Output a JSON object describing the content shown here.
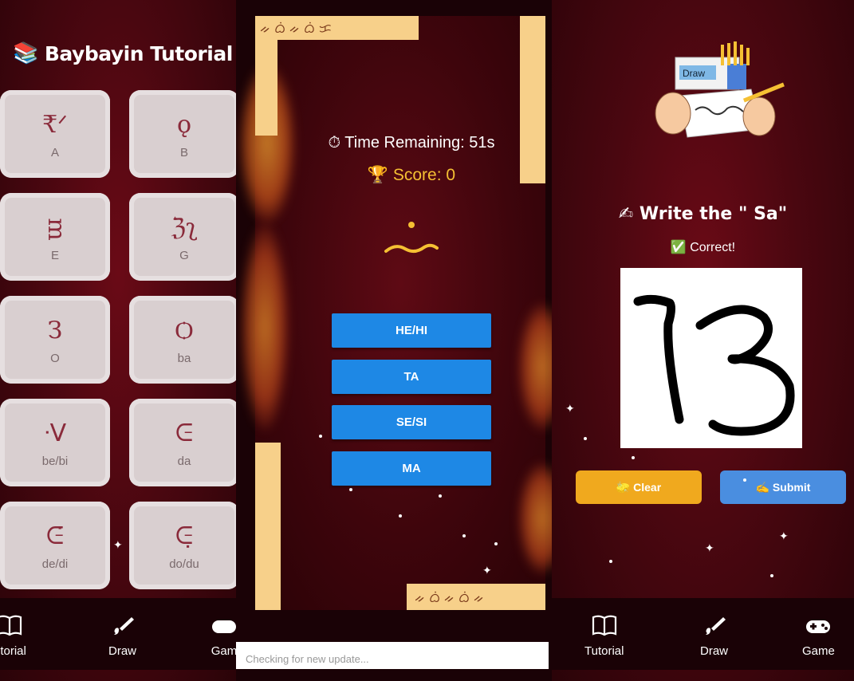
{
  "tutorial": {
    "title": "Baybayin Tutorial",
    "title_icon": "books-icon",
    "cards": [
      {
        "glyph": "ᜀ",
        "label": "A"
      },
      {
        "glyph": "ᜊ",
        "label": "B"
      },
      {
        "glyph": "ᜁ",
        "label": "E"
      },
      {
        "glyph": "ᜄ",
        "label": "G"
      },
      {
        "glyph": "ᜂ",
        "label": "O"
      },
      {
        "glyph": "ᜊ",
        "label": "ba"
      },
      {
        "glyph": "ᜊᜒ",
        "label": "be/bi"
      },
      {
        "glyph": "ᜇ",
        "label": "da"
      },
      {
        "glyph": "ᜇᜒ",
        "label": "de/di"
      },
      {
        "glyph": "ᜇᜓ",
        "label": "do/du"
      }
    ]
  },
  "game": {
    "timer_text": "⏱ Time Remaining: 51s",
    "score_text": "🏆 Score: 0",
    "choices": [
      "HE/HI",
      "TA",
      "SE/SI",
      "MA"
    ],
    "update_text": "Checking for new update..."
  },
  "draw": {
    "illustration_label": "Draw",
    "heading": "✍ Write the \" Sa\"",
    "feedback": "✅ Correct!",
    "clear_label": "🧽 Clear",
    "submit_label": "✍ Submit",
    "colors": {
      "clear": "#f0a91e",
      "submit": "#4a8ee0"
    }
  },
  "nav": {
    "tutorial": "Tutorial",
    "draw": "Draw",
    "game": "Game",
    "game_partial": "Gam",
    "tutorial_partial": "utorial"
  }
}
